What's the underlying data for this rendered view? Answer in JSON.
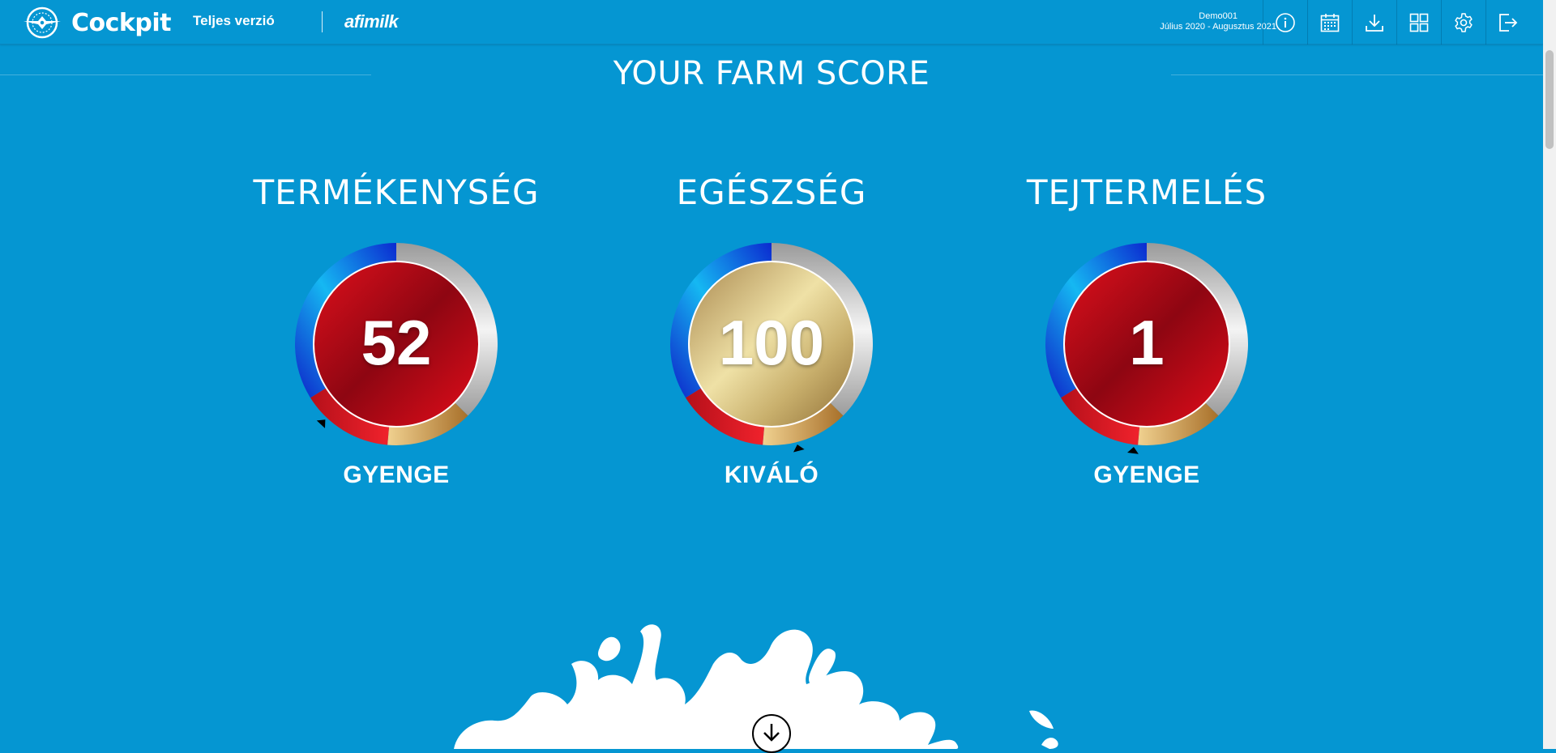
{
  "header": {
    "brand": "Cockpit",
    "version_label": "Teljes verzió",
    "partner": "afimilk",
    "farm_name": "Demo001",
    "period": "Július 2020 - Augusztus 2021",
    "toolbar_icons": [
      "info-icon",
      "calendar-icon",
      "download-icon",
      "grid-icon",
      "gear-icon",
      "logout-icon"
    ]
  },
  "section": {
    "title": "YOUR FARM SCORE"
  },
  "scores": [
    {
      "title": "TERMÉKENYSÉG",
      "value": "52",
      "rating": "GYENGE",
      "center": "red",
      "marker_position": 0.62
    },
    {
      "title": "EGÉSZSÉG",
      "value": "100",
      "rating": "KIVÁLÓ",
      "center": "gold",
      "marker_position": 0.46
    },
    {
      "title": "TEJTERMELÉS",
      "value": "1",
      "rating": "GYENGE",
      "center": "red",
      "marker_position": 0.52
    }
  ],
  "colors": {
    "background": "#0596d2",
    "ring_blue": "#1434d6",
    "ring_red": "#d4151f",
    "ring_gold": "#c58a3a",
    "ring_silver": "#c7c7c7"
  }
}
